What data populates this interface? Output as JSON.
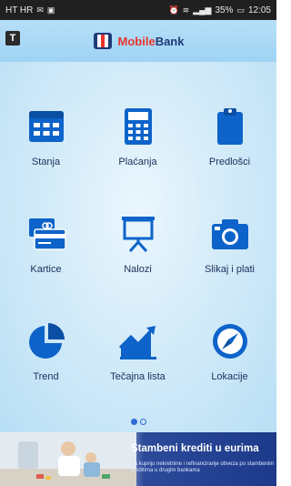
{
  "status_bar": {
    "carrier": "HT HR",
    "battery_text": "35%",
    "time": "12:05"
  },
  "app_bar": {
    "t_label": "T",
    "brand_mobile": "Mobile",
    "brand_bank": "Bank"
  },
  "menu": [
    {
      "label": "Stanja",
      "icon": "calendar-icon"
    },
    {
      "label": "Plaćanja",
      "icon": "calculator-icon"
    },
    {
      "label": "Predlošci",
      "icon": "clipboard-icon"
    },
    {
      "label": "Kartice",
      "icon": "cards-icon"
    },
    {
      "label": "Nalozi",
      "icon": "presentation-board-icon"
    },
    {
      "label": "Slikaj i plati",
      "icon": "camera-icon"
    },
    {
      "label": "Trend",
      "icon": "pie-chart-icon"
    },
    {
      "label": "Tečajna lista",
      "icon": "trend-chart-icon"
    },
    {
      "label": "Lokacije",
      "icon": "compass-icon"
    }
  ],
  "pager": {
    "pages": 2,
    "current": 1
  },
  "banner": {
    "title": "Stambeni krediti u eurima",
    "subtitle": "Za kupnju nekretnine i refinanciranje obveza po stambenim kreditima u drugim bankama"
  },
  "colors": {
    "icon_blue": "#0d63c9",
    "label_navy": "#1b2f5a",
    "brand_red": "#e8352c",
    "brand_navy": "#1f3a78"
  }
}
